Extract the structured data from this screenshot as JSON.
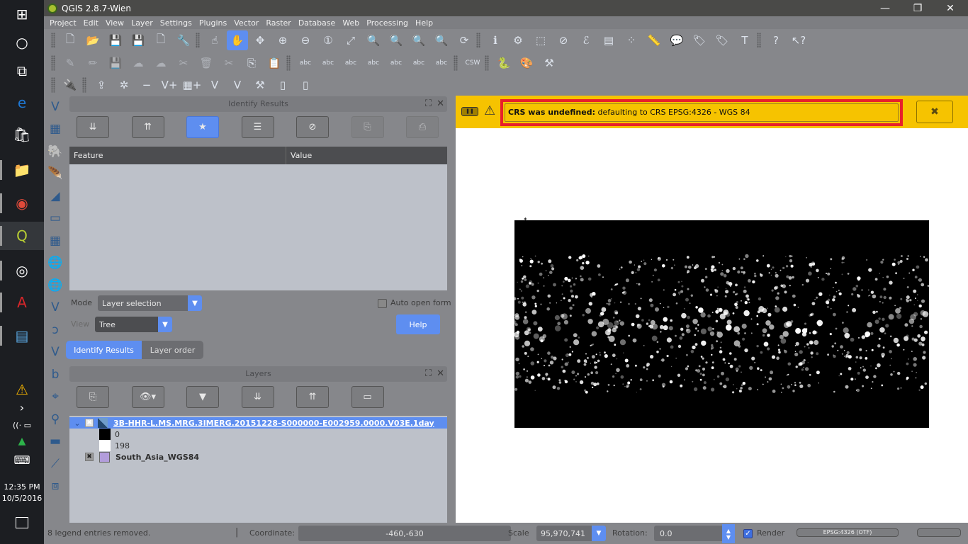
{
  "taskbar": {
    "icons": [
      {
        "name": "windows-start-icon",
        "glyph": "⊞"
      },
      {
        "name": "cortana-search-icon",
        "glyph": "○"
      },
      {
        "name": "task-view-icon",
        "glyph": "⧉"
      },
      {
        "name": "edge-browser-icon",
        "glyph": "e"
      },
      {
        "name": "store-icon",
        "glyph": "🛍"
      },
      {
        "name": "file-explorer-icon",
        "glyph": "📁"
      },
      {
        "name": "chrome-icon",
        "glyph": "◉"
      },
      {
        "name": "qgis-icon",
        "glyph": "Q"
      },
      {
        "name": "app-target-icon",
        "glyph": "◎"
      },
      {
        "name": "acrobat-icon",
        "glyph": "A"
      },
      {
        "name": "control-panel-icon",
        "glyph": "▤"
      }
    ],
    "tray": {
      "warning_glyph": "⚠",
      "chevron_glyph": "›",
      "wifi_glyph": "((·",
      "battery_glyph": "▭",
      "drive_glyph": "▲",
      "keyboard_glyph": "⌨"
    },
    "time": "12:35 PM",
    "date": "10/5/2016"
  },
  "window": {
    "title": "QGIS 2.8.7-Wien",
    "minimize": "—",
    "restore": "❐",
    "close": "✕"
  },
  "menu": [
    "Project",
    "Edit",
    "View",
    "Layer",
    "Settings",
    "Plugins",
    "Vector",
    "Raster",
    "Database",
    "Web",
    "Processing",
    "Help"
  ],
  "toolbar1": [
    {
      "name": "new-project-icon",
      "glyph": "🗋"
    },
    {
      "name": "open-project-icon",
      "glyph": "📂"
    },
    {
      "name": "save-project-icon",
      "glyph": "💾"
    },
    {
      "name": "save-as-icon",
      "glyph": "💾"
    },
    {
      "name": "new-print-composer-icon",
      "glyph": "🗋"
    },
    {
      "name": "composer-manager-icon",
      "glyph": "🔧"
    },
    {
      "name": "touch-zoom-pan-icon",
      "glyph": "☝"
    },
    {
      "name": "pan-map-icon",
      "glyph": "✋",
      "active": true
    },
    {
      "name": "pan-to-selection-icon",
      "glyph": "✥"
    },
    {
      "name": "zoom-in-icon",
      "glyph": "⊕"
    },
    {
      "name": "zoom-out-icon",
      "glyph": "⊖"
    },
    {
      "name": "zoom-native-resolution-icon",
      "glyph": "①"
    },
    {
      "name": "zoom-full-icon",
      "glyph": "⤢"
    },
    {
      "name": "zoom-to-selection-icon",
      "glyph": "🔍"
    },
    {
      "name": "zoom-to-layer-icon",
      "glyph": "🔍"
    },
    {
      "name": "zoom-last-icon",
      "glyph": "🔍"
    },
    {
      "name": "zoom-next-icon",
      "glyph": "🔍"
    },
    {
      "name": "refresh-icon",
      "glyph": "⟳"
    },
    {
      "name": "identify-features-icon",
      "glyph": "ℹ"
    },
    {
      "name": "run-feature-action-icon",
      "glyph": "⚙"
    },
    {
      "name": "select-features-icon",
      "glyph": "⬚"
    },
    {
      "name": "deselect-all-icon",
      "glyph": "⊘"
    },
    {
      "name": "select-by-expression-icon",
      "glyph": "ℰ"
    },
    {
      "name": "open-attribute-table-icon",
      "glyph": "▤"
    },
    {
      "name": "statistical-summary-icon",
      "glyph": "⁘"
    },
    {
      "name": "measure-line-icon",
      "glyph": "📏"
    },
    {
      "name": "map-tips-icon",
      "glyph": "💬"
    },
    {
      "name": "new-bookmark-icon",
      "glyph": "🏷"
    },
    {
      "name": "show-bookmarks-icon",
      "glyph": "🏷"
    },
    {
      "name": "text-annotation-icon",
      "glyph": "T"
    },
    {
      "name": "help-contents-icon",
      "glyph": "?"
    },
    {
      "name": "whats-this-icon",
      "glyph": "↖?"
    }
  ],
  "toolbar2": [
    {
      "name": "current-edits-icon",
      "glyph": "✎",
      "dim": true
    },
    {
      "name": "toggle-editing-icon",
      "glyph": "✏",
      "dim": true
    },
    {
      "name": "save-layer-edits-icon",
      "glyph": "💾",
      "dim": true
    },
    {
      "name": "add-feature-icon",
      "glyph": "☁",
      "dim": true
    },
    {
      "name": "move-feature-icon",
      "glyph": "☁",
      "dim": true
    },
    {
      "name": "node-tool-icon",
      "glyph": "✂",
      "dim": true
    },
    {
      "name": "delete-selected-icon",
      "glyph": "🗑",
      "dim": true
    },
    {
      "name": "cut-features-icon",
      "glyph": "✂",
      "dim": true
    },
    {
      "name": "copy-features-icon",
      "glyph": "⎘"
    },
    {
      "name": "paste-features-icon",
      "glyph": "📋"
    },
    {
      "name": "layer-labeling-icon",
      "glyph": "abc"
    },
    {
      "name": "pin-labels-icon",
      "glyph": "abc"
    },
    {
      "name": "highlight-pinned-labels-icon",
      "glyph": "abc"
    },
    {
      "name": "show-hide-labels-icon",
      "glyph": "abc"
    },
    {
      "name": "move-label-icon",
      "glyph": "abc"
    },
    {
      "name": "rotate-label-icon",
      "glyph": "abc"
    },
    {
      "name": "change-label-icon",
      "glyph": "abc"
    },
    {
      "name": "csw-icon",
      "glyph": "CSW"
    },
    {
      "name": "python-console-icon",
      "glyph": "🐍"
    },
    {
      "name": "style-manager-icon",
      "glyph": "🎨"
    },
    {
      "name": "processing-toolbox-icon",
      "glyph": "⚒"
    }
  ],
  "toolbar3": [
    {
      "name": "plugin-manager-icon",
      "glyph": "🔌"
    },
    {
      "name": "raster-upload-icon",
      "glyph": "⇪"
    },
    {
      "name": "raster-new-icon",
      "glyph": "✲"
    },
    {
      "name": "raster-remove-icon",
      "glyph": "−"
    },
    {
      "name": "add-vector-layer-icon",
      "glyph": "V+"
    },
    {
      "name": "add-raster-layer-icon",
      "glyph": "▦+"
    },
    {
      "name": "new-vector-icon",
      "glyph": "V"
    },
    {
      "name": "edit-vector-icon",
      "glyph": "V"
    },
    {
      "name": "tools-icon",
      "glyph": "⚒"
    },
    {
      "name": "print-layout-icon",
      "glyph": "▯"
    },
    {
      "name": "print-layout-edit-icon",
      "glyph": "▯"
    }
  ],
  "vtoolbar": [
    {
      "name": "add-vector-layer-icon",
      "glyph": "V"
    },
    {
      "name": "add-raster-layer-icon",
      "glyph": "▦"
    },
    {
      "name": "add-postgis-layer-icon",
      "glyph": "🐘"
    },
    {
      "name": "add-spatialite-layer-icon",
      "glyph": "🪶"
    },
    {
      "name": "add-mssql-layer-icon",
      "glyph": "◢"
    },
    {
      "name": "add-oracle-layer-icon",
      "glyph": "▭"
    },
    {
      "name": "add-wms-layer-icon",
      "glyph": "▦"
    },
    {
      "name": "add-wcs-layer-icon",
      "glyph": "🌐"
    },
    {
      "name": "add-wfs-layer-icon",
      "glyph": "🌐"
    },
    {
      "name": "add-delimited-text-icon",
      "glyph": "V"
    },
    {
      "name": "add-virtual-layer-icon",
      "glyph": "ɔ"
    },
    {
      "name": "new-shapefile-icon",
      "glyph": "V"
    },
    {
      "name": "new-spatialite-icon",
      "glyph": "b"
    },
    {
      "name": "coordinate-capture-icon",
      "glyph": "⌖"
    },
    {
      "name": "georeferencer-icon",
      "glyph": "⚲"
    },
    {
      "name": "gps-tool-icon",
      "glyph": "▬"
    },
    {
      "name": "topology-checker-icon",
      "glyph": "⟋"
    },
    {
      "name": "road-graph-icon",
      "glyph": "⧈"
    }
  ],
  "identify_panel": {
    "title": "Identify Results",
    "buttons": [
      {
        "name": "expand-tree-button",
        "glyph": "⇊"
      },
      {
        "name": "collapse-tree-button",
        "glyph": "⇈"
      },
      {
        "name": "expand-new-results-button",
        "glyph": "★",
        "active": true
      },
      {
        "name": "open-form-button",
        "glyph": "☰"
      },
      {
        "name": "clear-results-button",
        "glyph": "⊘"
      },
      {
        "name": "copy-feature-button",
        "glyph": "⎘",
        "dim": true
      },
      {
        "name": "print-button",
        "glyph": "⎙",
        "dim": true
      }
    ],
    "columns": [
      "Feature",
      "Value"
    ],
    "mode_label": "Mode",
    "mode_value": "Layer selection",
    "view_label": "View",
    "view_value": "Tree",
    "auto_open_form_label": "Auto open form",
    "help_label": "Help",
    "tabs": [
      "Identify Results",
      "Layer order"
    ]
  },
  "layers_panel": {
    "title": "Layers",
    "buttons": [
      {
        "name": "add-group-button",
        "glyph": "⎘"
      },
      {
        "name": "manage-visibility-button",
        "glyph": "👁▾"
      },
      {
        "name": "filter-legend-button",
        "glyph": "▼"
      },
      {
        "name": "expand-all-button",
        "glyph": "⇊"
      },
      {
        "name": "collapse-all-button",
        "glyph": "⇈"
      },
      {
        "name": "remove-layer-button",
        "glyph": "▭"
      }
    ],
    "layers": [
      {
        "name": "3B-HHR-L.MS.MRG.3IMERG.20151228-S000000-E002959.0000.V03E.1day",
        "legend": [
          {
            "value": "0",
            "color": "#000000"
          },
          {
            "value": "198",
            "color": "#ffffff"
          }
        ]
      },
      {
        "name": "South_Asia_WGS84",
        "color": "#b29ddb"
      }
    ]
  },
  "message_bar": {
    "bold": "CRS was undefined:",
    "text": " defaulting to CRS EPSG:4326 - WGS 84",
    "pause_glyph": "❚❚",
    "warning_glyph": "⚠",
    "close_glyph": "✖"
  },
  "status": {
    "message": "8 legend entries removed.",
    "coordinate_label": "Coordinate:",
    "coordinate_value": "-460,-630",
    "scale_label": "Scale",
    "scale_value": "95,970,741",
    "rotation_label": "Rotation:",
    "rotation_value": "0.0",
    "render_label": "Render",
    "crs_button": "EPSG:4326 (OTF)"
  }
}
